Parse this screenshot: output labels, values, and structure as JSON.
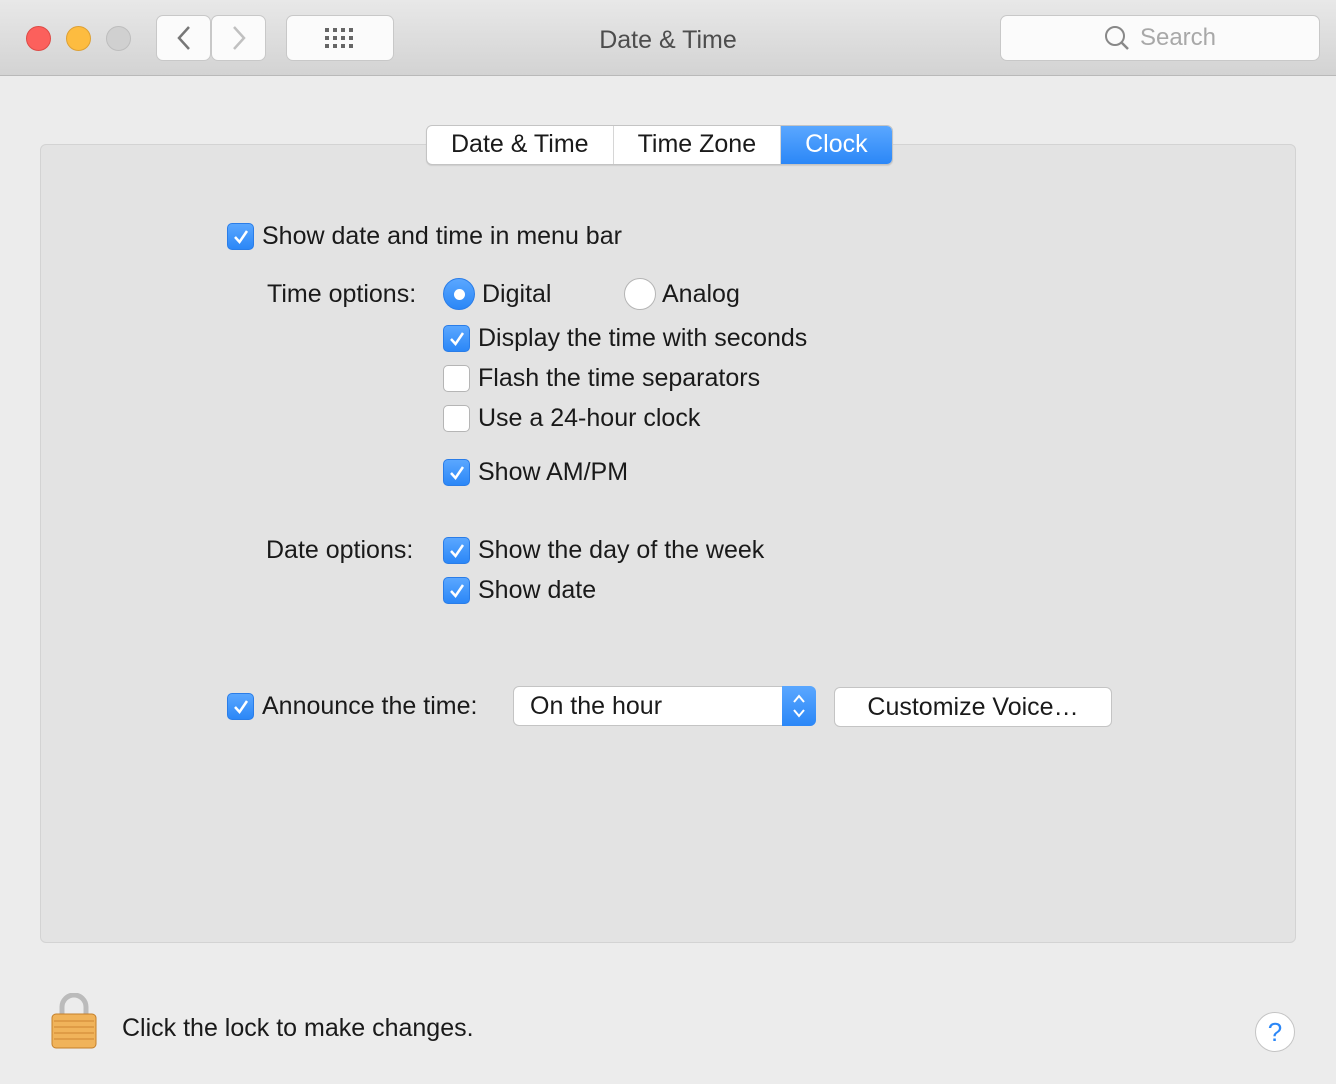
{
  "window": {
    "title": "Date & Time",
    "search_placeholder": "Search"
  },
  "tabs": [
    {
      "label": "Date & Time",
      "active": false
    },
    {
      "label": "Time Zone",
      "active": false
    },
    {
      "label": "Clock",
      "active": true
    }
  ],
  "clock": {
    "show_in_menu_bar": {
      "label": "Show date and time in menu bar",
      "checked": true
    },
    "time_options_label": "Time options:",
    "digital": {
      "label": "Digital",
      "selected": true
    },
    "analog": {
      "label": "Analog",
      "selected": false
    },
    "seconds": {
      "label": "Display the time with seconds",
      "checked": true
    },
    "flash": {
      "label": "Flash the time separators",
      "checked": false
    },
    "h24": {
      "label": "Use a 24-hour clock",
      "checked": false
    },
    "ampm": {
      "label": "Show AM/PM",
      "checked": true
    },
    "date_options_label": "Date options:",
    "day_of_week": {
      "label": "Show the day of the week",
      "checked": true
    },
    "show_date": {
      "label": "Show date",
      "checked": true
    },
    "announce": {
      "label": "Announce the time:",
      "checked": true,
      "value": "On the hour"
    },
    "customize_voice": "Customize Voice…"
  },
  "footer": {
    "lock_text": "Click the lock to make changes.",
    "help": "?"
  },
  "colors": {
    "accent": "#2b87f7",
    "close": "#fc605c",
    "minimize": "#fdbc40"
  }
}
